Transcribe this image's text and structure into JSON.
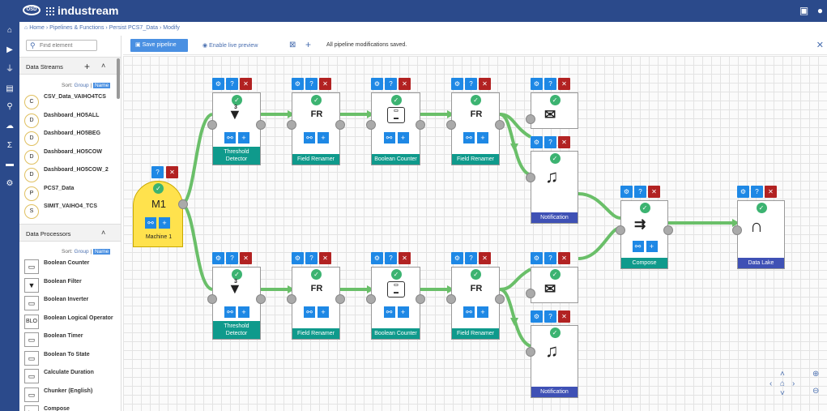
{
  "app": {
    "brand": "industream",
    "logo_text": "OSD"
  },
  "breadcrumb": {
    "home": "Home",
    "sep": "›",
    "pipelines": "Pipelines & Functions",
    "persist": "Persist PCS7_Data",
    "modify": "Modify"
  },
  "sidebar": {
    "search_placeholder": "Find element",
    "streams_title": "Data Streams",
    "processors_title": "Data Processors",
    "sort_label": "Sort:",
    "sort_group": "Group",
    "sort_sep": "|",
    "sort_name": "Name",
    "streams": [
      {
        "letter": "C",
        "label": "CSV_Data_VAIHO4TCS"
      },
      {
        "letter": "D",
        "label": "Dashboard_HO5ALL"
      },
      {
        "letter": "D",
        "label": "Dashboard_HO5BEG"
      },
      {
        "letter": "D",
        "label": "Dashboard_HO5COW"
      },
      {
        "letter": "D",
        "label": "Dashboard_HO5COW_2"
      },
      {
        "letter": "P",
        "label": "PCS7_Data"
      },
      {
        "letter": "S",
        "label": "SIMIT_VAIHO4_TCS"
      }
    ],
    "processors": [
      {
        "icon": "counter-icon",
        "label": "Boolean Counter"
      },
      {
        "icon": "filter-icon",
        "label": "Boolean Filter"
      },
      {
        "icon": "inverter-icon",
        "label": "Boolean Inverter"
      },
      {
        "icon": "blo-icon",
        "label": "Boolean Logical Operator",
        "icon_text": "BLO"
      },
      {
        "icon": "timer-icon",
        "label": "Boolean Timer"
      },
      {
        "icon": "state-icon",
        "label": "Boolean To State"
      },
      {
        "icon": "duration-icon",
        "label": "Calculate Duration"
      },
      {
        "icon": "chunker-icon",
        "label": "Chunker (English)"
      },
      {
        "icon": "compose-icon",
        "label": "Compose"
      }
    ]
  },
  "toolbar": {
    "save_label": "Save pipeline",
    "preview_label": "Enable live preview",
    "status": "All pipeline modifications saved."
  },
  "nodes": {
    "source": {
      "title": "M1",
      "label": "Machine 1"
    },
    "threshold": "Threshold Detector",
    "renamer": "Field Renamer",
    "renamer_icon": "FR",
    "counter": "Boolean Counter",
    "notification": "Notification",
    "compose": "Compose",
    "sink": "Data Lake",
    "threshold_icon_num": "3"
  },
  "colors": {
    "edge": "#6abf69",
    "teal": "#0f9a8c",
    "navy": "#3f51b5",
    "topbar": "#2b4a8b",
    "source": "#ffe24d"
  }
}
